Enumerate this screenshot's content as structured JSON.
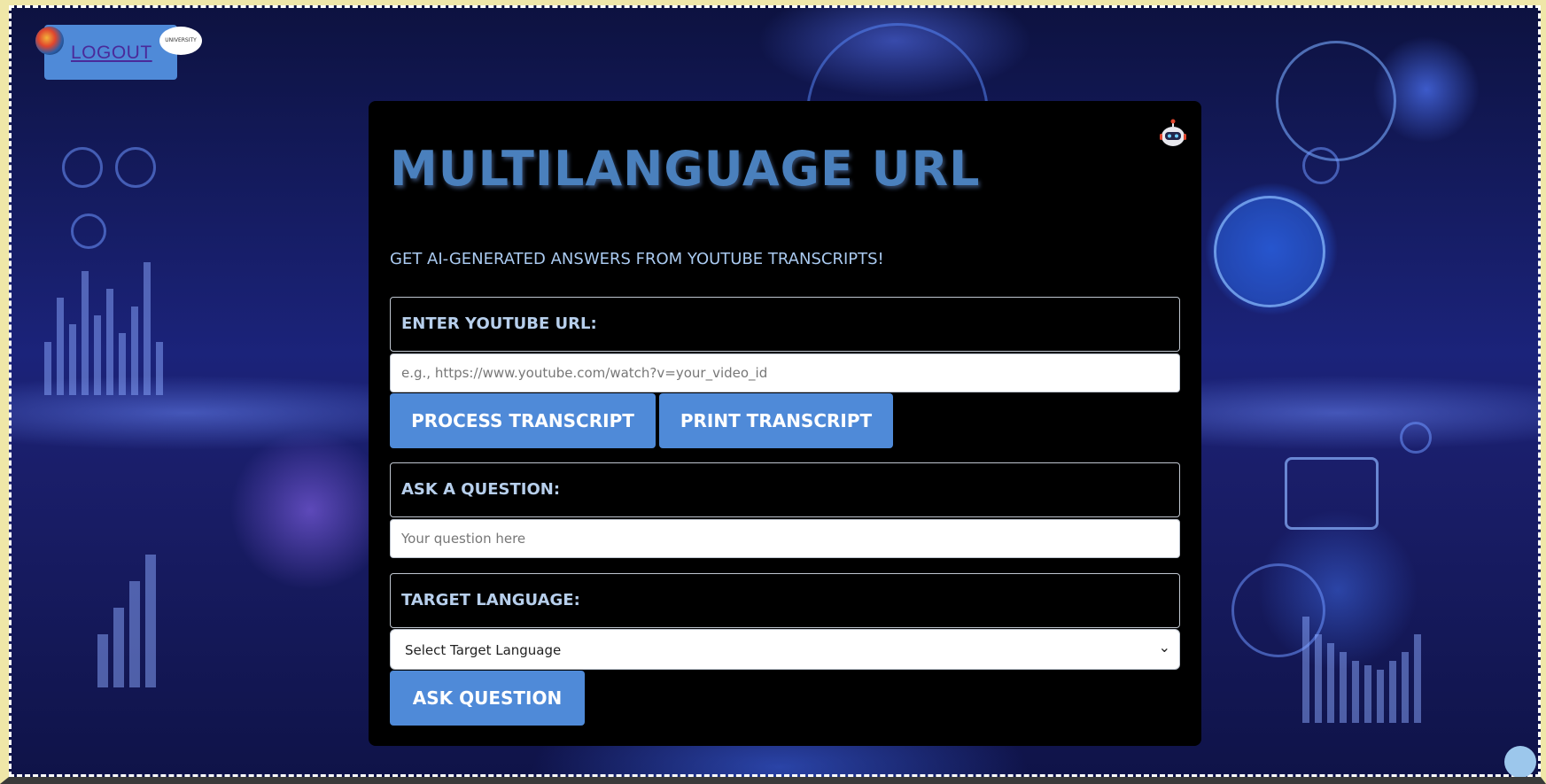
{
  "header": {
    "logout_label": "LOGOUT",
    "logo_left_icon": "app-logo-icon",
    "logo_right_text": "UNIVERSITY"
  },
  "panel": {
    "title": "MULTILANGUAGE URL",
    "subtitle": "GET AI-GENERATED ANSWERS FROM YOUTUBE TRANSCRIPTS!",
    "robot_icon": "robot-icon",
    "url_label": "ENTER YOUTUBE URL:",
    "url_input": {
      "placeholder": "e.g., https://www.youtube.com/watch?v=your_video_id",
      "value": ""
    },
    "process_button": "PROCESS TRANSCRIPT",
    "print_button": "PRINT TRANSCRIPT",
    "question_label": "ASK A QUESTION:",
    "question_input": {
      "placeholder": "Your question here",
      "value": ""
    },
    "language_label": "TARGET LANGUAGE:",
    "language_select": {
      "selected": "Select Target Language"
    },
    "ask_button": "ASK QUESTION"
  },
  "colors": {
    "accent": "#4f8ad8",
    "title": "#4a80bd",
    "panel_bg": "#000000",
    "label_text": "#b7cfec"
  }
}
